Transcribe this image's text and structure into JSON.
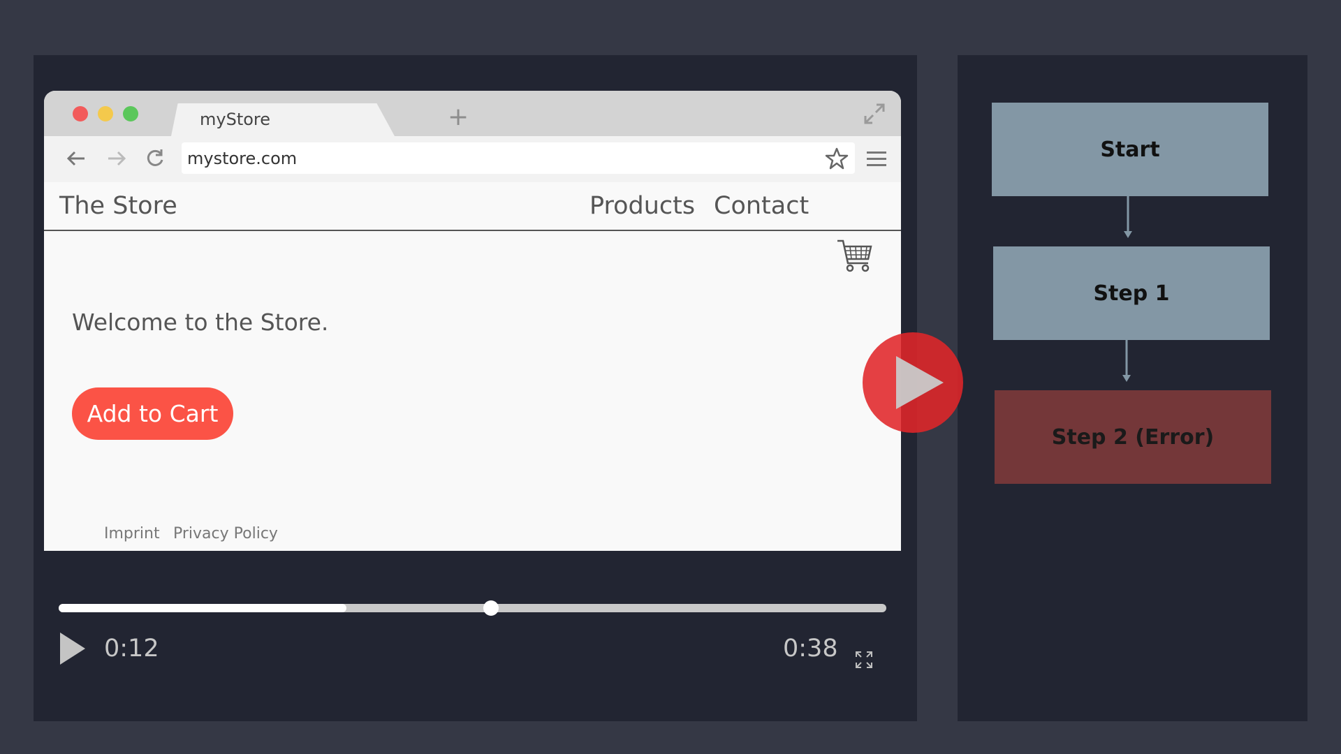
{
  "browser": {
    "tab_title": "myStore",
    "url": "mystore.com"
  },
  "site": {
    "brand": "The Store",
    "nav": [
      "Products",
      "Contact"
    ],
    "welcome": "Welcome to the Store.",
    "cta_label": "Add to Cart",
    "footer": [
      "Imprint",
      "Privacy Policy"
    ]
  },
  "player": {
    "current_time": "0:12",
    "duration": "0:38",
    "progress_fraction": 0.348,
    "playhead_fraction": 0.522
  },
  "flow": {
    "steps": [
      {
        "label": "Start",
        "status": "ok"
      },
      {
        "label": "Step 1",
        "status": "ok"
      },
      {
        "label": "Step 2 (Error)",
        "status": "error"
      }
    ]
  },
  "colors": {
    "accent": "#fb5346",
    "play_button": "#e02529",
    "step_ok": "#8397a5",
    "step_error": "#743739"
  },
  "icons": [
    "back-arrow-icon",
    "forward-arrow-icon",
    "reload-icon",
    "star-icon",
    "menu-icon",
    "cart-icon",
    "expand-icon",
    "play-icon",
    "fullscreen-icon"
  ]
}
